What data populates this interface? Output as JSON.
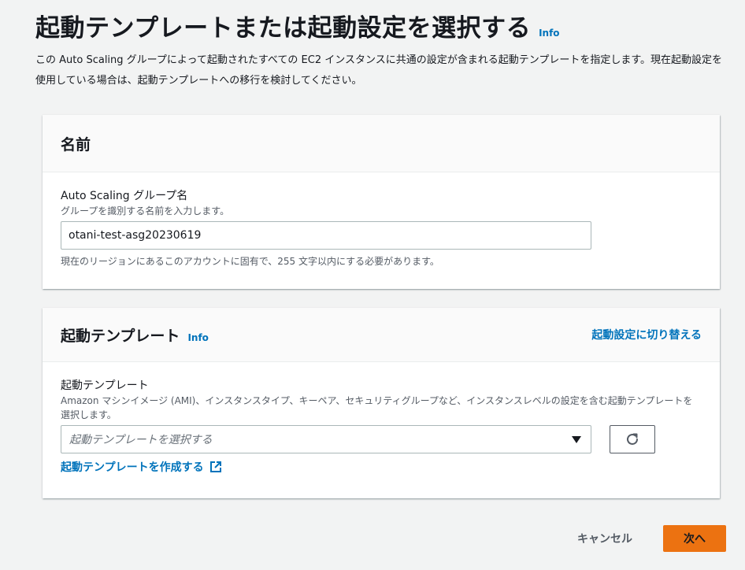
{
  "header": {
    "title": "起動テンプレートまたは起動設定を選択する",
    "info": "Info",
    "description": "この Auto Scaling グループによって起動されたすべての EC2 インスタンスに共通の設定が含まれる起動テンプレートを指定します。現在起動設定を使用している場合は、起動テンプレートへの移行を検討してください。"
  },
  "name_panel": {
    "title": "名前",
    "field_label": "Auto Scaling グループ名",
    "field_desc": "グループを識別する名前を入力します。",
    "value": "otani-test-asg20230619",
    "constraint": "現在のリージョンにあるこのアカウントに固有で、255 文字以内にする必要があります。"
  },
  "template_panel": {
    "title": "起動テンプレート",
    "info": "Info",
    "switch_link": "起動設定に切り替える",
    "field_label": "起動テンプレート",
    "field_desc": "Amazon マシンイメージ (AMI)、インスタンスタイプ、キーペア、セキュリティグループなど、インスタンスレベルの設定を含む起動テンプレートを選択します。",
    "select_placeholder": "起動テンプレートを選択する",
    "create_link": "起動テンプレートを作成する"
  },
  "footer": {
    "cancel": "キャンセル",
    "next": "次へ"
  },
  "colors": {
    "link": "#0073bb",
    "primary": "#ec7211",
    "background": "#f2f3f3"
  },
  "icons": {
    "dropdown": "caret-down-icon",
    "refresh": "refresh-icon",
    "external": "external-link-icon"
  }
}
